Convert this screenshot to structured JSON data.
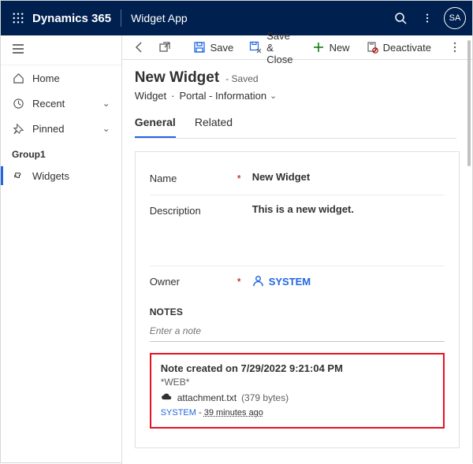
{
  "topbar": {
    "brand": "Dynamics 365",
    "app_name": "Widget App",
    "avatar_initials": "SA"
  },
  "sidebar": {
    "items": [
      {
        "label": "Home"
      },
      {
        "label": "Recent"
      },
      {
        "label": "Pinned"
      }
    ],
    "group_label": "Group1",
    "group_items": [
      {
        "label": "Widgets"
      }
    ]
  },
  "commands": {
    "save": "Save",
    "save_close": "Save & Close",
    "new": "New",
    "deactivate": "Deactivate"
  },
  "page": {
    "title": "New Widget",
    "saved_suffix": "- Saved",
    "entity": "Widget",
    "sep": "·",
    "form_name": "Portal - Information"
  },
  "tabs": {
    "general": "General",
    "related": "Related"
  },
  "fields": {
    "name_label": "Name",
    "name_value": "New Widget",
    "desc_label": "Description",
    "desc_value": "This is a new widget.",
    "owner_label": "Owner",
    "owner_value": "SYSTEM",
    "required": "*"
  },
  "notes": {
    "heading": "NOTES",
    "placeholder": "Enter a note",
    "card": {
      "title": "Note created on 7/29/2022 9:21:04 PM",
      "source": "*WEB*",
      "attachment_name": "attachment.txt",
      "attachment_size": "(379 bytes)",
      "author": "SYSTEM",
      "sep": " - ",
      "ago": "39 minutes ago"
    }
  }
}
